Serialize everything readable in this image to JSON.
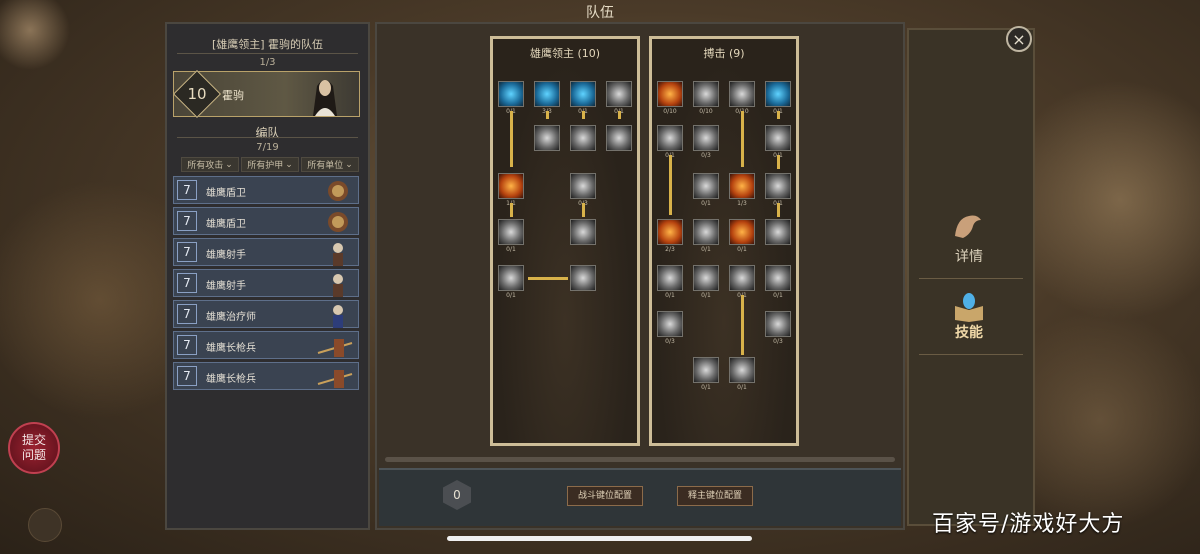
{
  "window": {
    "title": "队伍"
  },
  "report_button": {
    "label": "提交\n问题"
  },
  "left_panel": {
    "team_title": "[雄鹰领主] 霍驹的队伍",
    "team_count": "1/3",
    "hero": {
      "level": "10",
      "name": "霍驹"
    },
    "formation_label": "编队",
    "formation_count": "7/19",
    "filters": [
      "所有攻击",
      "所有护甲",
      "所有单位"
    ],
    "units": [
      {
        "level": "7",
        "name": "雄鹰盾卫"
      },
      {
        "level": "7",
        "name": "雄鹰盾卫"
      },
      {
        "level": "7",
        "name": "雄鹰射手"
      },
      {
        "level": "7",
        "name": "雄鹰射手"
      },
      {
        "level": "7",
        "name": "雄鹰治疗师"
      },
      {
        "level": "7",
        "name": "雄鹰长枪兵"
      },
      {
        "level": "7",
        "name": "雄鹰长枪兵"
      }
    ]
  },
  "trees": [
    {
      "title": "雄鹰领主 (10)"
    },
    {
      "title": "搏击 (9)"
    }
  ],
  "bottom_bar": {
    "points": "0",
    "combat_key_config": "战斗键位配置",
    "trait_key_config": "释主键位配置"
  },
  "right_panel": {
    "details_label": "详情",
    "skills_label": "技能"
  },
  "watermark": "百家号/游戏好大方"
}
